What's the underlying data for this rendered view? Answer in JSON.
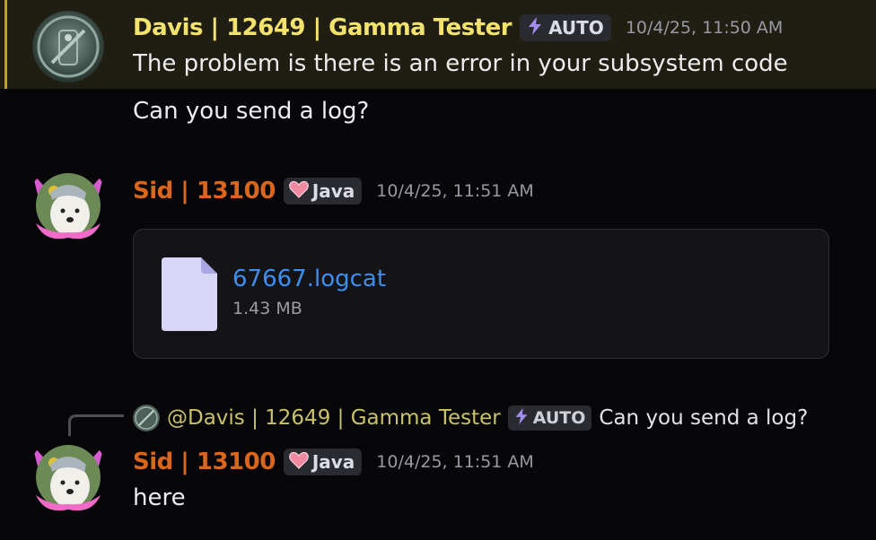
{
  "messages": [
    {
      "author": "Davis | 12649 | Gamma Tester",
      "badge": "AUTO",
      "timestamp": "10/4/25, 11:50 AM",
      "lines": [
        "The problem is there is an error in your subsystem code",
        "Can you send a log?"
      ]
    },
    {
      "author": "Sid | 13100",
      "badge": "Java",
      "timestamp": "10/4/25, 11:51 AM",
      "attachment": {
        "filename": "67667.logcat",
        "size": "1.43 MB"
      }
    },
    {
      "reply_to": {
        "mention": "@Davis | 12649 | Gamma Tester",
        "badge": "AUTO",
        "text": "Can you send a log?"
      },
      "author": "Sid | 13100",
      "badge": "Java",
      "timestamp": "10/4/25, 11:51 AM",
      "lines": [
        "here"
      ]
    }
  ],
  "colors": {
    "davis_name": "#f3e36d",
    "sid_name": "#d9661d",
    "link": "#3e8ef0",
    "highlight_bar": "#c2a12f",
    "highlight_bg": "#201e12"
  },
  "icons": {
    "auto_badge": "lightning-icon",
    "java_badge": "heart-icon",
    "attachment": "file-icon"
  }
}
